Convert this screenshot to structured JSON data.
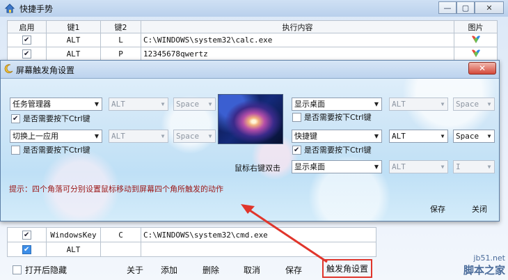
{
  "main": {
    "title": "快捷手势",
    "table": {
      "headers": [
        "启用",
        "键1",
        "键2",
        "执行内容",
        "图片"
      ],
      "rows": [
        {
          "enabled": true,
          "key1": "ALT",
          "key2": "L",
          "content": "C:\\WINDOWS\\system32\\calc.exe"
        },
        {
          "enabled": true,
          "key1": "ALT",
          "key2": "P",
          "content": "12345678qwertz"
        }
      ]
    },
    "bottom_rows": [
      {
        "enabled": true,
        "key1": "WindowsKey",
        "key2": "C",
        "content": "C:\\WINDOWS\\system32\\cmd.exe"
      },
      {
        "enabled": true,
        "key1": "ALT",
        "key2": "",
        "content": ""
      }
    ],
    "footer": {
      "hide_on_open": "打开后隐藏",
      "about": "关于",
      "add": "添加",
      "delete": "删除",
      "cancel": "取消",
      "save": "保存",
      "trigger_settings": "触发角设置"
    }
  },
  "dialog": {
    "title": "屏幕触发角设置",
    "top_left": {
      "action": "任务管理器",
      "key1": "ALT",
      "key2": "Space",
      "need_ctrl_label": "是否需要按下Ctrl键",
      "need_ctrl": true
    },
    "top_right": {
      "action": "显示桌面",
      "key1": "ALT",
      "key2": "Space",
      "need_ctrl_label": "是否需要按下Ctrl键",
      "need_ctrl": false
    },
    "bottom_left": {
      "action": "切换上一应用",
      "key1": "ALT",
      "key2": "Space",
      "need_ctrl_label": "是否需要按下Ctrl键",
      "need_ctrl": false
    },
    "bottom_right": {
      "action": "快捷键",
      "key1": "ALT",
      "key2": "Space",
      "need_ctrl_label": "是否需要按下Ctrl键",
      "need_ctrl": true
    },
    "right_double": {
      "label": "鼠标右键双击",
      "action": "显示桌面",
      "key1": "ALT",
      "key2": "I"
    },
    "hint": "提示：四个角落可分别设置鼠标移动到屏幕四个角所触发的动作",
    "save": "保存",
    "close": "关闭"
  },
  "watermark": {
    "site": "jb51.net",
    "name": "脚本之家"
  },
  "colors": {
    "accent_red": "#e0352b",
    "hint_red": "#9b1717"
  }
}
